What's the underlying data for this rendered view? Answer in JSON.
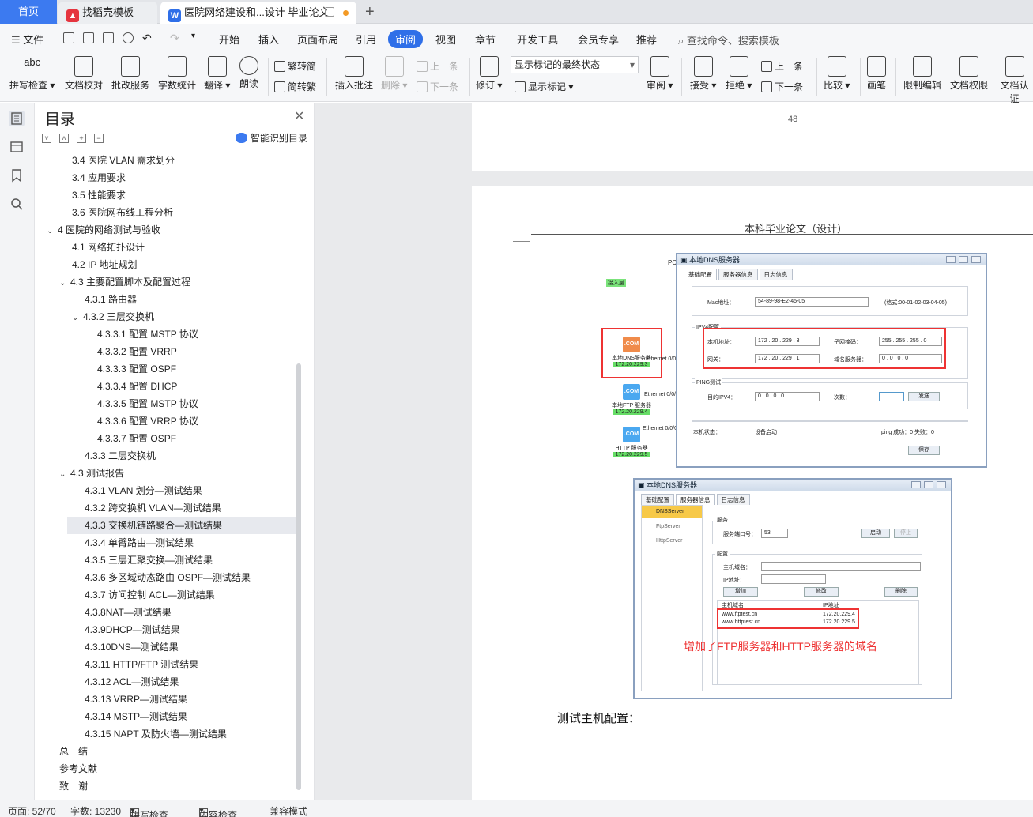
{
  "tabs": {
    "home": "首页",
    "template": "找稻壳模板",
    "document": "医院网络建设和...设计 毕业论文",
    "new_tab": "+"
  },
  "menu": {
    "file": "文件",
    "items": [
      "开始",
      "插入",
      "页面布局",
      "引用",
      "审阅",
      "视图",
      "章节",
      "开发工具",
      "会员专享",
      "推荐"
    ],
    "active": "审阅",
    "search": "查找命令、搜索模板"
  },
  "ribbon": {
    "spell": "拼写检查",
    "spell_icon_text": "abc",
    "doc_check": "文档校对",
    "batch_service": "批改服务",
    "word_count": "字数统计",
    "translate": "翻译",
    "read_aloud": "朗读",
    "trad": "繁转简",
    "simp": "简转繁",
    "insert_comment": "插入批注",
    "delete": "删除",
    "prev": "上一条",
    "next": "下一条",
    "revise": "修订",
    "markup_state": "显示标记的最终状态",
    "show_markup": "显示标记",
    "review": "审阅",
    "accept": "接受",
    "reject": "拒绝",
    "prev2": "上一条",
    "next2": "下一条",
    "compare": "比较",
    "pen": "画笔",
    "restrict": "限制编辑",
    "doc_rights": "文档权限",
    "doc_cert": "文档认证"
  },
  "toc": {
    "title": "目录",
    "smart": "智能识别目录",
    "items": [
      {
        "text": "3.4 医院 VLAN 需求划分",
        "level": 2,
        "arrow": ""
      },
      {
        "text": "3.4 应用要求",
        "level": 2,
        "arrow": ""
      },
      {
        "text": "3.5 性能要求",
        "level": 2,
        "arrow": ""
      },
      {
        "text": "3.6 医院网布线工程分析",
        "level": 2,
        "arrow": ""
      },
      {
        "text": "4 医院的网络测试与验收",
        "level": 1,
        "arrow": "v"
      },
      {
        "text": "4.1 网络拓扑设计",
        "level": 2,
        "arrow": ""
      },
      {
        "text": "4.2 IP 地址规划",
        "level": 2,
        "arrow": ""
      },
      {
        "text": "4.3 主要配置脚本及配置过程",
        "level": 2,
        "arrow": "v"
      },
      {
        "text": "4.3.1 路由器",
        "level": 3,
        "arrow": ""
      },
      {
        "text": "4.3.2 三层交换机",
        "level": 3,
        "arrow": "v"
      },
      {
        "text": "4.3.3.1 配置 MSTP 协议",
        "level": 4,
        "arrow": ""
      },
      {
        "text": "4.3.3.2 配置 VRRP",
        "level": 4,
        "arrow": ""
      },
      {
        "text": "4.3.3.3 配置 OSPF",
        "level": 4,
        "arrow": ""
      },
      {
        "text": "4.3.3.4 配置 DHCP",
        "level": 4,
        "arrow": ""
      },
      {
        "text": "4.3.3.5 配置 MSTP 协议",
        "level": 4,
        "arrow": ""
      },
      {
        "text": "4.3.3.6 配置 VRRP 协议",
        "level": 4,
        "arrow": ""
      },
      {
        "text": "4.3.3.7 配置 OSPF",
        "level": 4,
        "arrow": ""
      },
      {
        "text": "4.3.3 二层交换机",
        "level": 3,
        "arrow": ""
      },
      {
        "text": "4.3 测试报告",
        "level": 2,
        "arrow": "v"
      },
      {
        "text": "4.3.1 VLAN 划分—测试结果",
        "level": 3,
        "arrow": ""
      },
      {
        "text": "4.3.2 跨交换机 VLAN—测试结果",
        "level": 3,
        "arrow": ""
      },
      {
        "text": "4.3.3 交换机链路聚合—测试结果",
        "level": 3,
        "arrow": "",
        "selected": true
      },
      {
        "text": "4.3.4 单臂路由—测试结果",
        "level": 3,
        "arrow": ""
      },
      {
        "text": "4.3.5 三层汇聚交换—测试结果",
        "level": 3,
        "arrow": ""
      },
      {
        "text": "4.3.6 多区域动态路由 OSPF—测试结果",
        "level": 3,
        "arrow": ""
      },
      {
        "text": "4.3.7 访问控制 ACL—测试结果",
        "level": 3,
        "arrow": ""
      },
      {
        "text": "4.3.8NAT—测试结果",
        "level": 3,
        "arrow": ""
      },
      {
        "text": "4.3.9DHCP—测试结果",
        "level": 3,
        "arrow": ""
      },
      {
        "text": "4.3.10DNS—测试结果",
        "level": 3,
        "arrow": ""
      },
      {
        "text": "4.3.11 HTTP/FTP 测试结果",
        "level": 3,
        "arrow": ""
      },
      {
        "text": "4.3.12 ACL—测试结果",
        "level": 3,
        "arrow": ""
      },
      {
        "text": "4.3.13 VRRP—测试结果",
        "level": 3,
        "arrow": ""
      },
      {
        "text": "4.3.14 MSTP—测试结果",
        "level": 3,
        "arrow": ""
      },
      {
        "text": "4.3.15 NAPT 及防火墙—测试结果",
        "level": 3,
        "arrow": ""
      },
      {
        "text": "总　结",
        "level": 1,
        "arrow": ""
      },
      {
        "text": "参考文献",
        "level": 1,
        "arrow": ""
      },
      {
        "text": "致　谢",
        "level": 1,
        "arrow": ""
      }
    ]
  },
  "doc": {
    "page_number": "48",
    "header": "本科毕业论文（设计）",
    "body_text": "测试主机配置：",
    "caption": "增加了FTP服务器和HTTP服务器的域名",
    "shot1": {
      "title": "本地DNS服务器",
      "tabs": [
        "基础配置",
        "服务器信息",
        "日志信息"
      ],
      "mac_label": "Mac地址：",
      "mac_value": "54-89-98-E2-45-05",
      "mac_hint": "(格式:00-01-02-03-04-05)",
      "ipv4_group": "IPV4配置",
      "ip_label": "本机地址：",
      "ip_value": "172 . 20 . 229 . 3",
      "mask_label": "子网掩码：",
      "mask_value": "255 . 255 . 255 . 0",
      "gw_label": "网关：",
      "gw_value": "172 . 20 . 229 . 1",
      "dns_label": "域名服务器：",
      "dns_value": "0 . 0 . 0 . 0",
      "ping_group": "PING测试",
      "dest_label": "目的IPV4：",
      "dest_value": "0 . 0 . 0 . 0",
      "count_label": "次数：",
      "send": "发送",
      "state_label": "本机状态：",
      "state_value": "设备启动",
      "ping_result": "ping 成功：0 失败：0",
      "save": "保存"
    },
    "topo": {
      "access_layer": "接入层",
      "pc": "PC",
      "dns_name": "本地DNS服务器",
      "dns_ip": "172.20.229.3",
      "ftp_name": "本地FTP 服务器",
      "ftp_ip": "172.20.229.4",
      "http_name": "HTTP 服务器",
      "http_ip": "172.20.229.5",
      "link1": "Ethernet 0/0/",
      "link2": "Ethernet 0/0/",
      "link3": "Ethernet 0/0/0",
      "com": ".COM"
    },
    "shot2": {
      "title": "本地DNS服务器",
      "tabs": [
        "基础配置",
        "服务器信息",
        "日志信息"
      ],
      "servers": [
        "DNSServer",
        "FtpServer",
        "HttpServer"
      ],
      "service_group": "服务",
      "port_label": "服务端口号：",
      "port_value": "53",
      "start": "启动",
      "stop": "停止",
      "config_group": "配置",
      "host_label": "主机域名：",
      "ip_label": "IP地址：",
      "add": "增加",
      "modify": "修改",
      "delete": "删除",
      "col_host": "主机域名",
      "col_ip": "IP地址",
      "rows": [
        {
          "host": "www.ftptest.cn",
          "ip": "172.20.229.4"
        },
        {
          "host": "www.httptest.cn",
          "ip": "172.20.229.5"
        }
      ]
    }
  },
  "status": {
    "page": "页面: 52/70",
    "words": "字数: 13230",
    "spell": "拼写检查",
    "content": "内容检查",
    "compat": "兼容模式"
  },
  "colors": {
    "accent": "#2f6fe8",
    "home_tab": "#3c7af0",
    "highlight_red": "#e33333",
    "ip_green": "#66dd66"
  }
}
